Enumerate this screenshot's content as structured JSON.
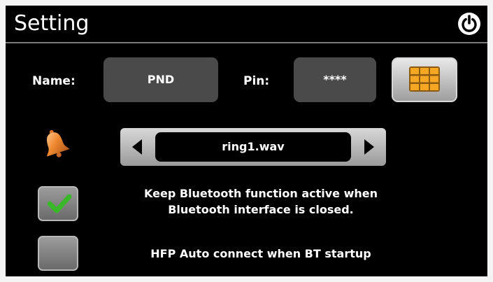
{
  "header": {
    "title": "Setting",
    "power_icon": "power-icon"
  },
  "fields": {
    "name_label": "Name:",
    "name_value": "PND",
    "pin_label": "Pin:",
    "pin_value": "****",
    "keypad_icon": "keypad-icon"
  },
  "ringtone": {
    "icon": "bell-icon",
    "value": "ring1.wav",
    "prev_icon": "triangle-left-icon",
    "next_icon": "triangle-right-icon"
  },
  "options": [
    {
      "checked": true,
      "line1": "Keep Bluetooth function active when",
      "line2": "Bluetooth interface is closed."
    },
    {
      "checked": false,
      "line1": "HFP Auto connect when BT startup"
    }
  ],
  "colors": {
    "background": "#000000",
    "text": "#ffffff",
    "field_box": "#4a4a4a",
    "keypad_orange": "#f0a020",
    "check_green": "#3ab82a",
    "bell_orange": "#f08a30"
  }
}
